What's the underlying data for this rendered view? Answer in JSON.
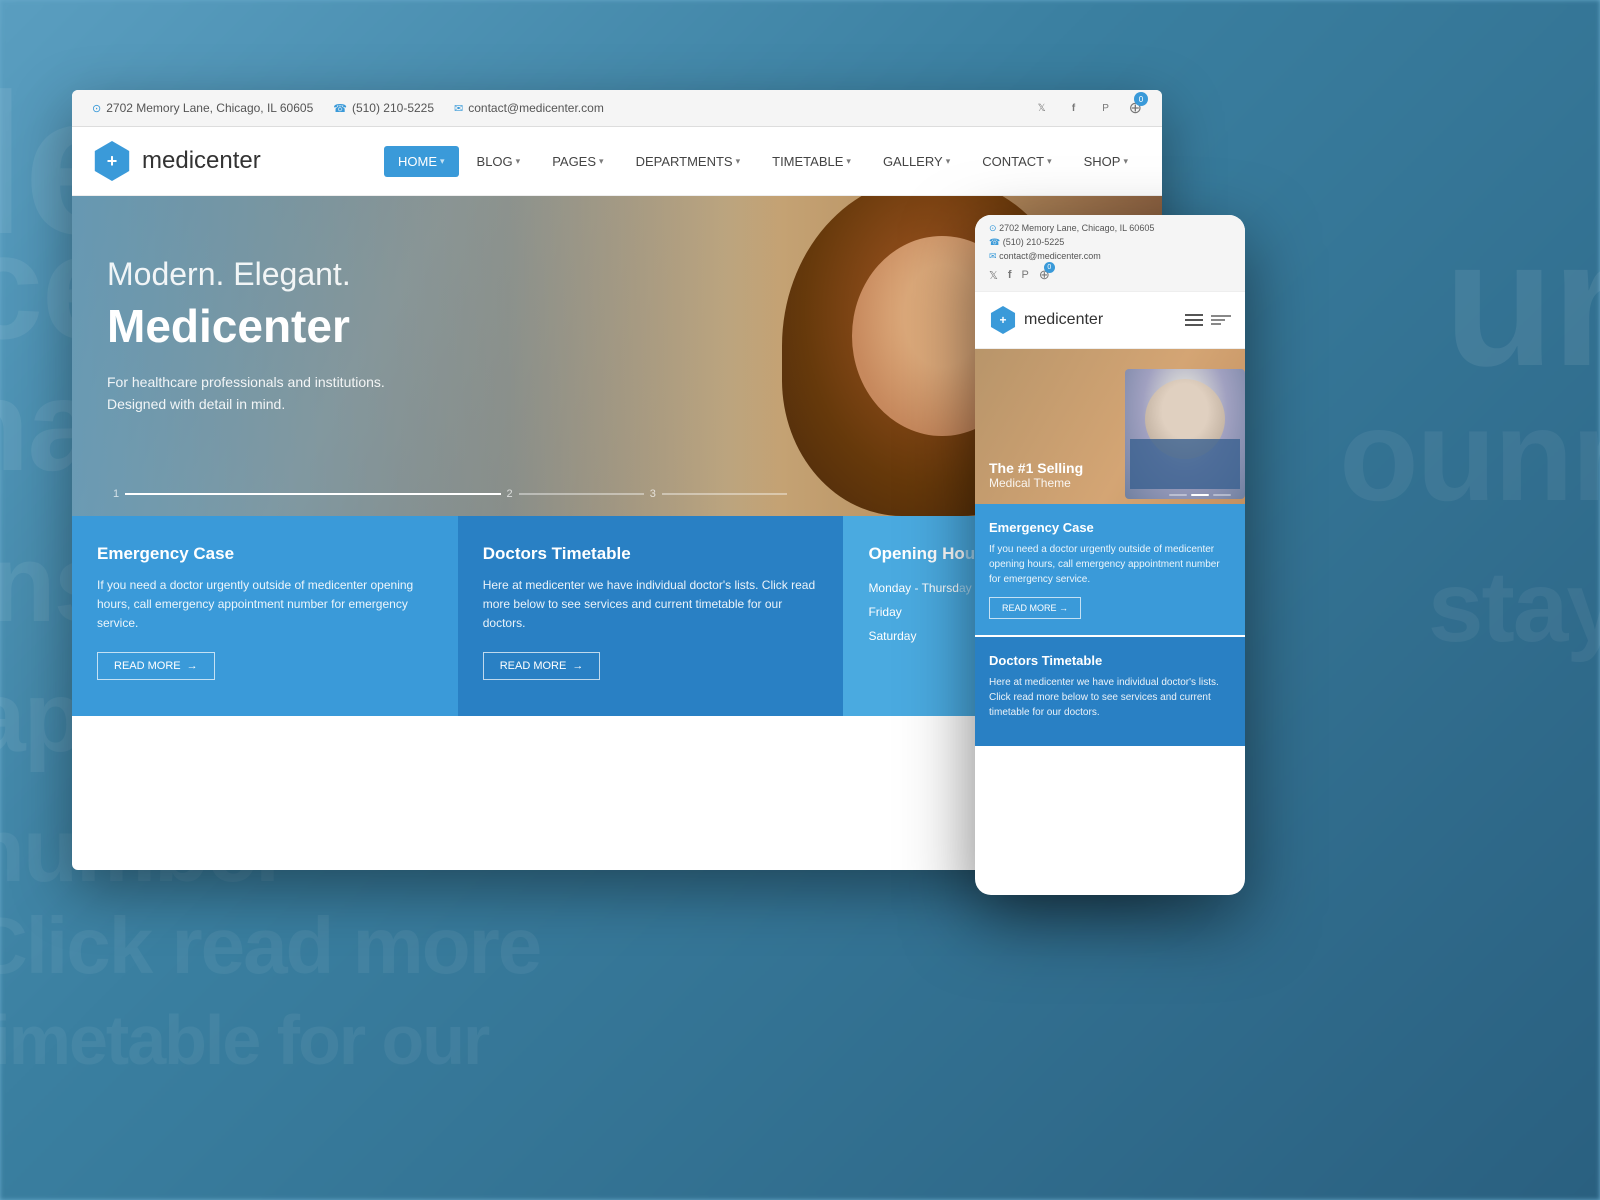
{
  "background": {
    "color": "#5a9ec0"
  },
  "desktop": {
    "topbar": {
      "address": "2702 Memory Lane, Chicago, IL 60605",
      "phone": "(510) 210-5225",
      "email": "contact@medicenter.com",
      "cart_count": "0",
      "social": [
        "twitter",
        "facebook",
        "pinterest"
      ]
    },
    "nav": {
      "logo_text": "medicenter",
      "items": [
        {
          "label": "HOME",
          "active": true,
          "has_dropdown": true
        },
        {
          "label": "BLOG",
          "active": false,
          "has_dropdown": true
        },
        {
          "label": "PAGES",
          "active": false,
          "has_dropdown": true
        },
        {
          "label": "DEPARTMENTS",
          "active": false,
          "has_dropdown": true
        },
        {
          "label": "TIMETABLE",
          "active": false,
          "has_dropdown": true
        },
        {
          "label": "GALLERY",
          "active": false,
          "has_dropdown": true
        },
        {
          "label": "CONTACT",
          "active": false,
          "has_dropdown": true
        },
        {
          "label": "SHOP",
          "active": false,
          "has_dropdown": true
        }
      ]
    },
    "hero": {
      "tagline": "Modern. Elegant.",
      "title": "Medicenter",
      "description_line1": "For healthcare professionals and institutions.",
      "description_line2": "Designed with detail in mind.",
      "slides": [
        "1",
        "2",
        "3"
      ]
    },
    "cards": [
      {
        "title": "Emergency Case",
        "text": "If you need a doctor urgently outside of medicenter opening hours, call emergency appointment number for emergency service.",
        "btn_label": "READ MORE",
        "color": "blue1"
      },
      {
        "title": "Doctors Timetable",
        "text": "Here at medicenter we have individual doctor's lists. Click read more below to see services and current timetable for our doctors.",
        "btn_label": "READ MORE",
        "color": "blue2"
      },
      {
        "title": "Opening Ho",
        "rows": [
          {
            "day": "Monday - Thursd",
            "hours": ""
          },
          {
            "day": "Friday",
            "hours": ""
          },
          {
            "day": "Saturday",
            "hours": ""
          }
        ],
        "color": "blue3"
      }
    ]
  },
  "mobile": {
    "topbar": {
      "address": "2702 Memory Lane, Chicago, IL 60605",
      "phone": "(510) 210-5225",
      "email": "contact@medicenter.com"
    },
    "nav": {
      "logo_text": "medicenter"
    },
    "hero": {
      "line1": "The #1 Selling",
      "line2": "Medical Theme",
      "slide_num": "2"
    },
    "cards": [
      {
        "title": "Emergency Case",
        "text": "If you need a doctor urgently outside of medicenter opening hours, call emergency appointment number for emergency service.",
        "btn_label": "READ MORE →"
      },
      {
        "title": "Doctors Timetable",
        "text": "Here at medicenter we have individual doctor's lists. Click read more below to see services and current timetable for our doctors.",
        "btn_label": ""
      }
    ]
  }
}
